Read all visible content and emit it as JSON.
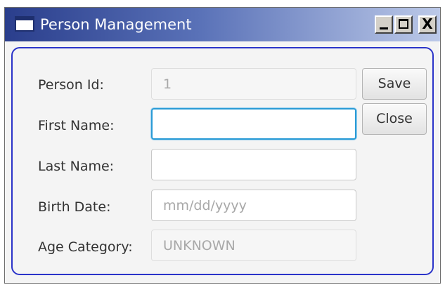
{
  "window": {
    "title": "Person Management",
    "close_glyph": "X"
  },
  "form": {
    "person_id": {
      "label": "Person Id:",
      "value": "1"
    },
    "first_name": {
      "label": "First Name:",
      "value": ""
    },
    "last_name": {
      "label": "Last Name:",
      "value": ""
    },
    "birth_date": {
      "label": "Birth Date:",
      "value": "",
      "placeholder": "mm/dd/yyyy"
    },
    "age_category": {
      "label": "Age Category:",
      "value": "UNKNOWN"
    }
  },
  "buttons": {
    "save": "Save",
    "close": "Close"
  },
  "colors": {
    "accent_border": "#2b34c9",
    "focus": "#2a9bd6"
  },
  "icons": [
    "app-window-icon",
    "minimize-icon",
    "maximize-icon",
    "close-icon"
  ]
}
